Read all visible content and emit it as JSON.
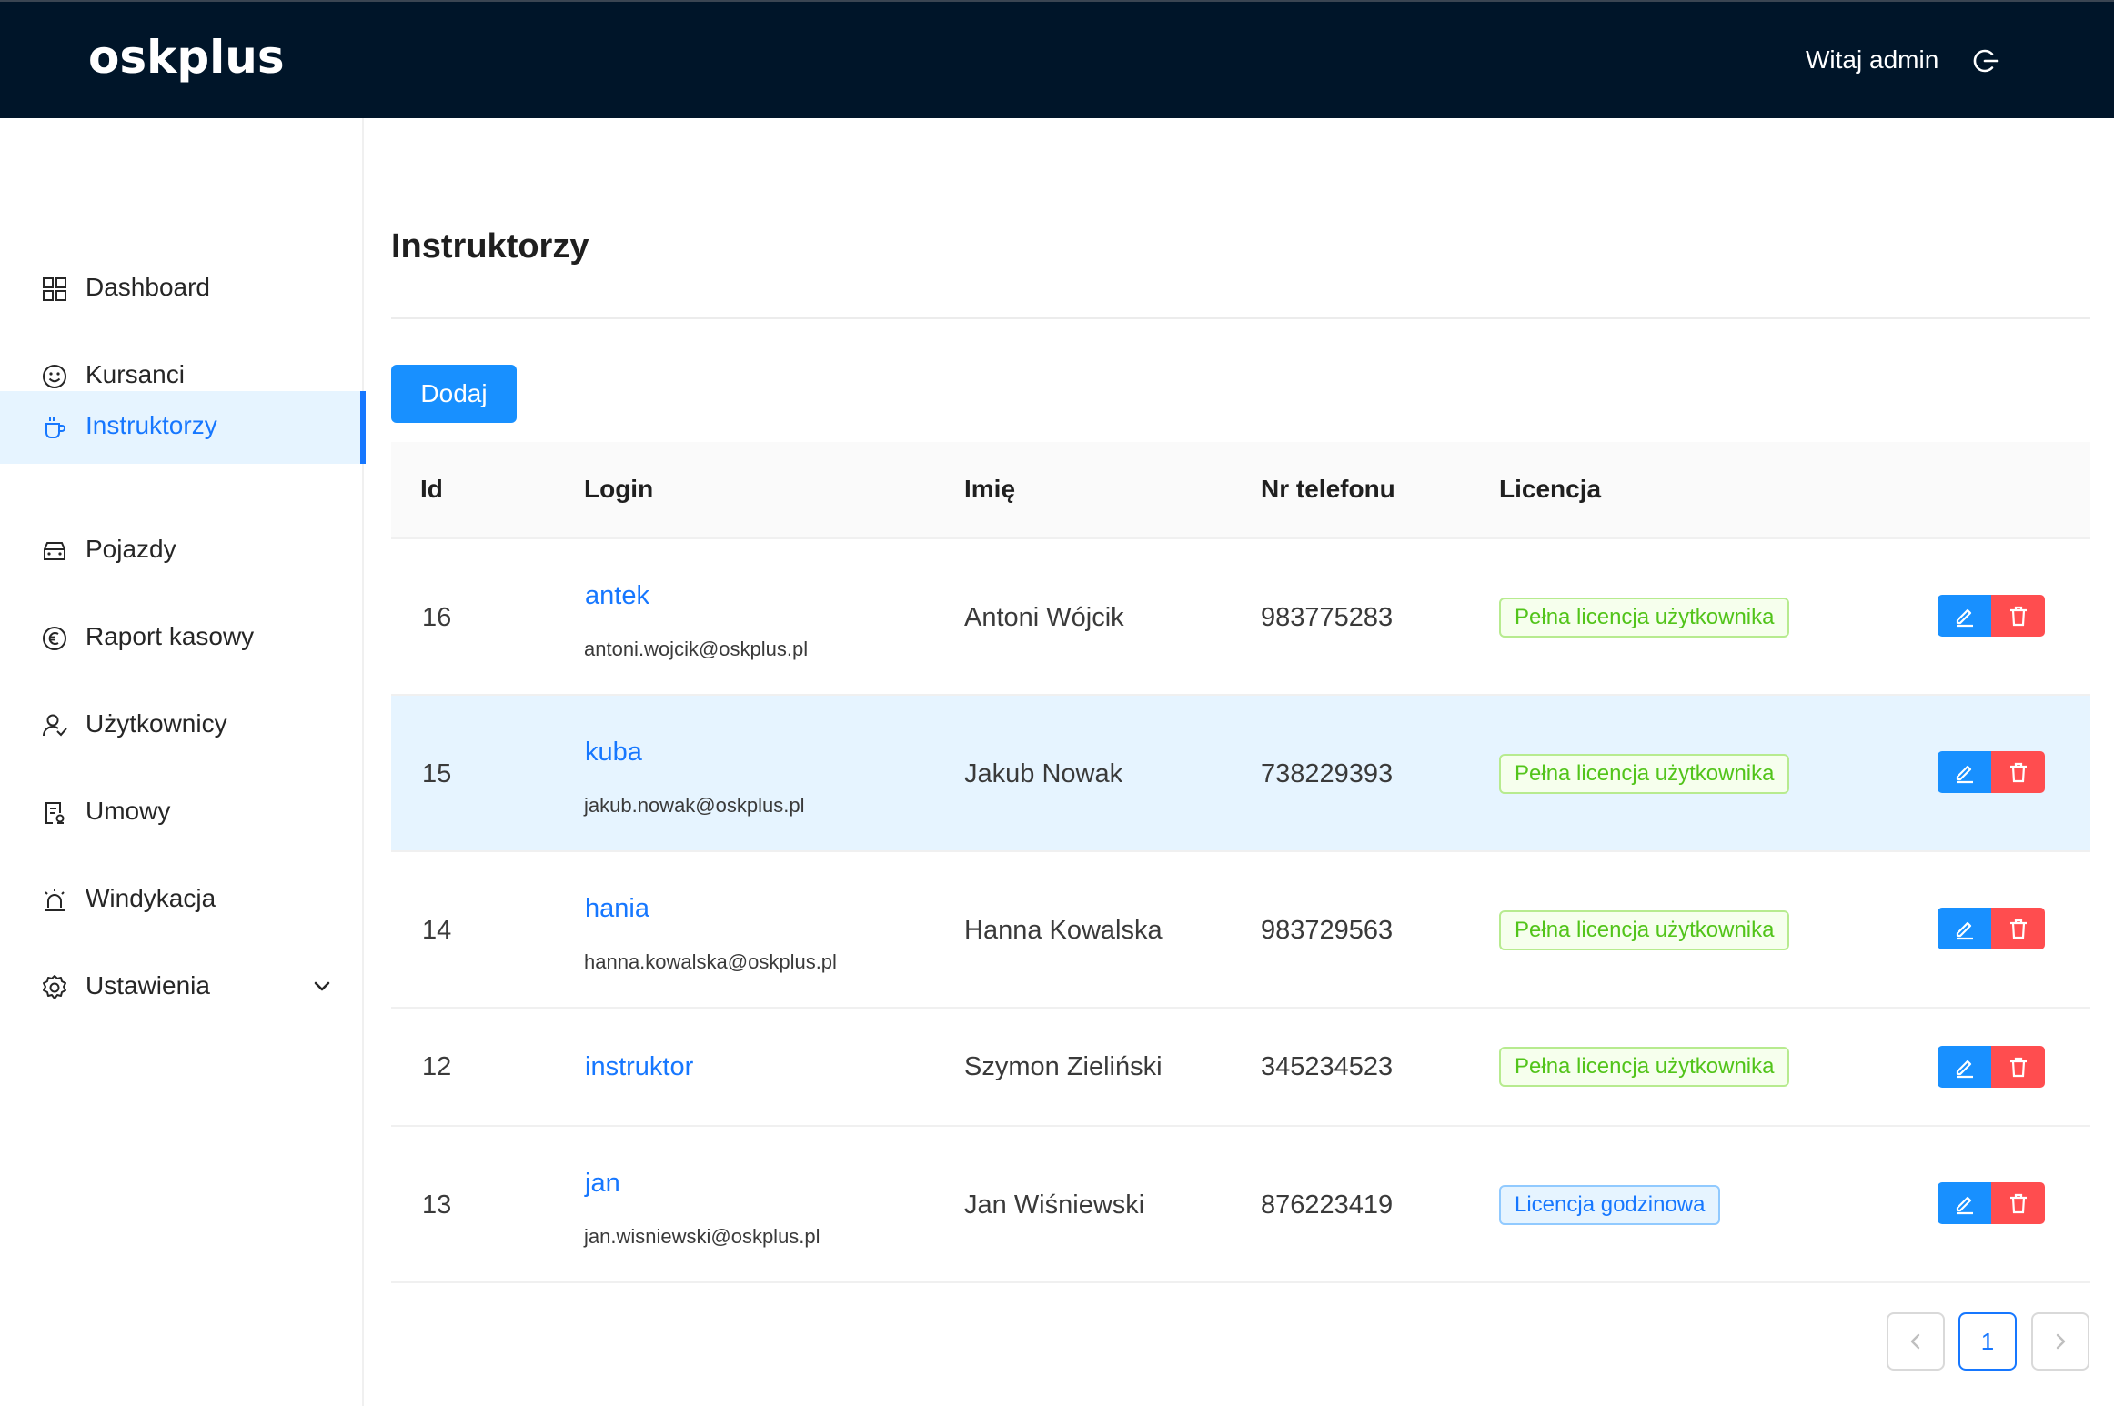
{
  "header": {
    "brand": "oskplus",
    "greeting": "Witaj admin",
    "logout_icon": "logout-icon"
  },
  "sidebar": {
    "items": [
      {
        "label": "Dashboard",
        "icon": "dashboard-icon",
        "active": false
      },
      {
        "label": "Kursanci",
        "icon": "smile-icon",
        "active": false
      },
      {
        "label": "Instruktorzy",
        "icon": "coffee-icon",
        "active": true
      },
      {
        "label": "Pojazdy",
        "icon": "car-icon",
        "active": false
      },
      {
        "label": "Raport kasowy",
        "icon": "euro-icon",
        "active": false
      },
      {
        "label": "Użytkownicy",
        "icon": "user-switch-icon",
        "active": false
      },
      {
        "label": "Umowy",
        "icon": "contract-icon",
        "active": false
      },
      {
        "label": "Windykacja",
        "icon": "alert-icon",
        "active": false
      },
      {
        "label": "Ustawienia",
        "icon": "settings-icon",
        "active": false,
        "has_submenu": true
      }
    ]
  },
  "main": {
    "title": "Instruktorzy",
    "add_label": "Dodaj",
    "columns": [
      "Id",
      "Login",
      "Imię",
      "Nr telefonu",
      "Licencja"
    ],
    "rows": [
      {
        "id": "16",
        "login": "antek",
        "email": "antoni.wojcik@oskplus.pl",
        "name": "Antoni Wójcik",
        "phone": "983775283",
        "license": "Pełna licencja użytkownika",
        "license_type": "full"
      },
      {
        "id": "15",
        "login": "kuba",
        "email": "jakub.nowak@oskplus.pl",
        "name": "Jakub Nowak",
        "phone": "738229393",
        "license": "Pełna licencja użytkownika",
        "license_type": "full"
      },
      {
        "id": "14",
        "login": "hania",
        "email": "hanna.kowalska@oskplus.pl",
        "name": "Hanna Kowalska",
        "phone": "983729563",
        "license": "Pełna licencja użytkownika",
        "license_type": "full"
      },
      {
        "id": "12",
        "login": "instruktor",
        "email": "",
        "name": "Szymon Zieliński",
        "phone": "345234523",
        "license": "Pełna licencja użytkownika",
        "license_type": "full"
      },
      {
        "id": "13",
        "login": "jan",
        "email": "jan.wisniewski@oskplus.pl",
        "name": "Jan Wiśniewski",
        "phone": "876223419",
        "license": "Licencja godzinowa",
        "license_type": "hourly"
      }
    ]
  },
  "pagination": {
    "current_page": "1",
    "prev_icon": "chevron-left-icon",
    "next_icon": "chevron-right-icon"
  },
  "colors": {
    "header_bg": "#001529",
    "primary": "#1890ff",
    "danger": "#ff4d4f",
    "active_bg": "#e6f4ff",
    "tag_green": "#52c41a"
  }
}
